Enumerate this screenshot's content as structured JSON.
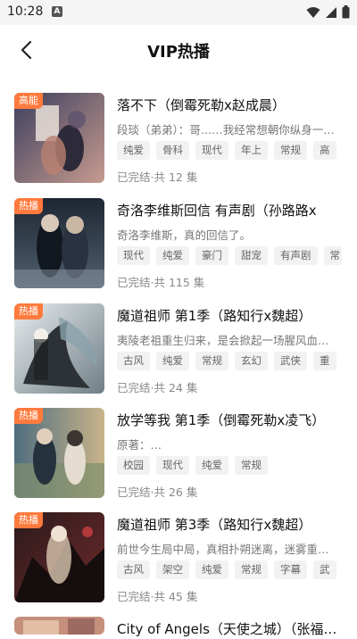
{
  "status_bar": {
    "time": "10:28",
    "notif_letter": "A"
  },
  "header": {
    "title": "VIP热播"
  },
  "colors": {
    "badge": "#ff7a3d",
    "tag_bg": "#f2f2f2"
  },
  "items": [
    {
      "badge": "高能",
      "title": "落不下（倒霉死勒x赵成晨）",
      "desc": "段琰（弟弟）：哥……我经常想朝你纵身一…",
      "tags": [
        "纯爱",
        "骨科",
        "现代",
        "年上",
        "常规",
        "高"
      ],
      "status": "已完结·共 12 集"
    },
    {
      "badge": "热播",
      "title": "奇洛李维斯回信 有声剧（孙路路x",
      "desc": "奇洛李维斯，真的回信了。",
      "tags": [
        "现代",
        "纯爱",
        "豪门",
        "甜宠",
        "有声剧",
        "常"
      ],
      "status": "已完结·共 115 集"
    },
    {
      "badge": "热播",
      "title": "魔道祖师 第1季（路知行x魏超）",
      "desc": "夷陵老祖重生归来，是会掀起一场腥风血…",
      "tags": [
        "古风",
        "纯爱",
        "常规",
        "玄幻",
        "武侠",
        "重"
      ],
      "status": "已完结·共 24 集"
    },
    {
      "badge": "热播",
      "title": "放学等我 第1季（倒霉死勒x凌飞）",
      "desc": "原著：…",
      "tags": [
        "校园",
        "现代",
        "纯爱",
        "常规"
      ],
      "status": "已完结·共 26 集"
    },
    {
      "badge": "热播",
      "title": "魔道祖师 第3季（路知行x魏超）",
      "desc": "前世今生局中局，真相扑朔迷离，迷雾重…",
      "tags": [
        "古风",
        "架空",
        "纯爱",
        "常规",
        "字幕",
        "武"
      ],
      "status": "已完结·共 45 集"
    },
    {
      "badge": "",
      "title": "City of Angels（天使之城）（张福…",
      "desc": "",
      "tags": [],
      "status": ""
    }
  ]
}
